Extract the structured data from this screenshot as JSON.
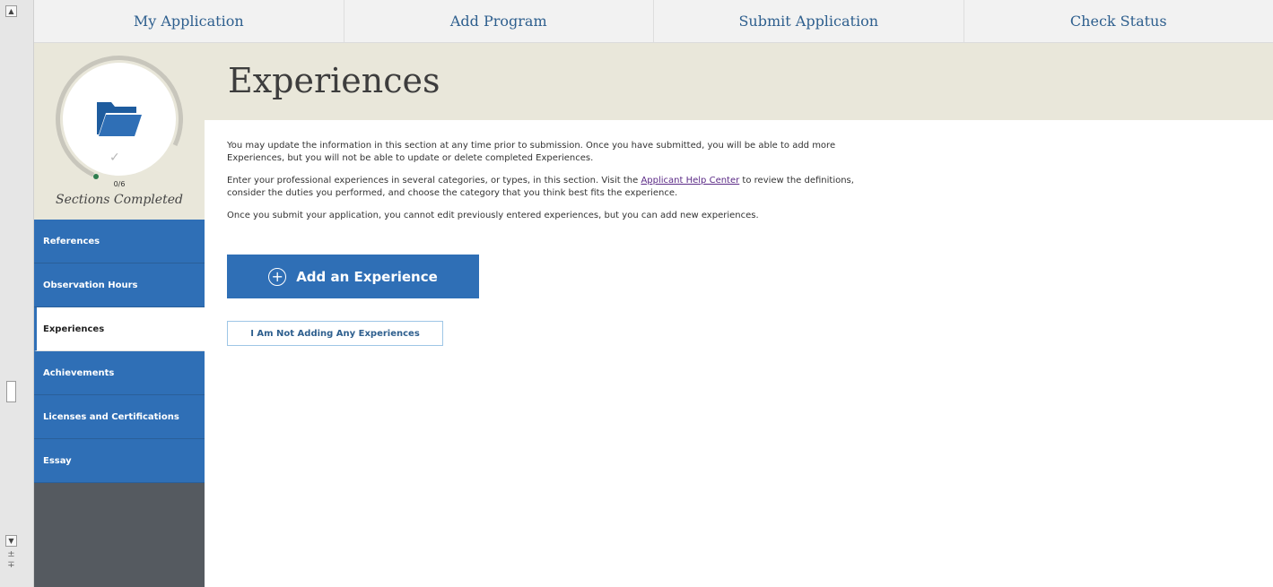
{
  "topnav": {
    "tabs": [
      {
        "label": "My Application"
      },
      {
        "label": "Add Program"
      },
      {
        "label": "Submit Application"
      },
      {
        "label": "Check Status"
      }
    ]
  },
  "progress": {
    "completed": "0/6",
    "label": "Sections Completed",
    "fraction": 0
  },
  "sidebar": {
    "items": [
      {
        "label": "References"
      },
      {
        "label": "Observation Hours"
      },
      {
        "label": "Experiences"
      },
      {
        "label": "Achievements"
      },
      {
        "label": "Licenses and Certifications"
      },
      {
        "label": "Essay"
      }
    ],
    "active": "Experiences"
  },
  "page": {
    "title": "Experiences",
    "para1": "You may update the information in this section at any time prior to submission. Once you have submitted, you will be able to add more Experiences, but you will not be able to update or delete completed Experiences.",
    "para2_before": "Enter your professional experiences in several categories, or types, in this section. Visit the ",
    "para2_link": "Applicant Help Center",
    "para2_after": " to review the definitions, consider the duties you performed, and choose the category that you think best fits the experience.",
    "para3": "Once you submit your application, you cannot edit previously entered experiences, but you can add new experiences.",
    "add_button": "Add an Experience",
    "none_button": "I Am Not Adding Any Experiences"
  },
  "colors": {
    "brand_blue": "#2f6fb6",
    "beige": "#e9e7da",
    "link_purple": "#5b2a86"
  }
}
